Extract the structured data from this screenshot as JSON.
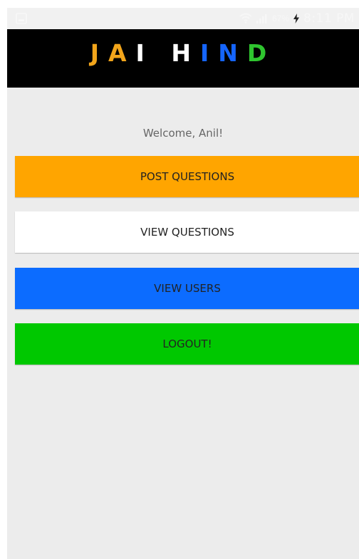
{
  "status_bar": {
    "battery": "67%",
    "time": "8:11 PM"
  },
  "app_bar": {
    "title_letters": [
      {
        "char": "J",
        "color": "#f2a51b"
      },
      {
        "char": "A",
        "color": "#f2a51b"
      },
      {
        "char": "I",
        "color": "#ffffff"
      },
      {
        "char": " ",
        "color": "#ffffff"
      },
      {
        "char": "H",
        "color": "#ffffff"
      },
      {
        "char": "I",
        "color": "#1565ff"
      },
      {
        "char": "N",
        "color": "#1565ff"
      },
      {
        "char": "D",
        "color": "#2fc52f"
      }
    ]
  },
  "main": {
    "welcome": "Welcome, Anil!",
    "buttons": [
      {
        "label": "POST QUESTIONS",
        "color": "#ffa500"
      },
      {
        "label": "VIEW QUESTIONS",
        "color": "#ffffff"
      },
      {
        "label": "VIEW USERS",
        "color": "#0c6cff"
      },
      {
        "label": "LOGOUT!",
        "color": "#00c800"
      }
    ]
  }
}
